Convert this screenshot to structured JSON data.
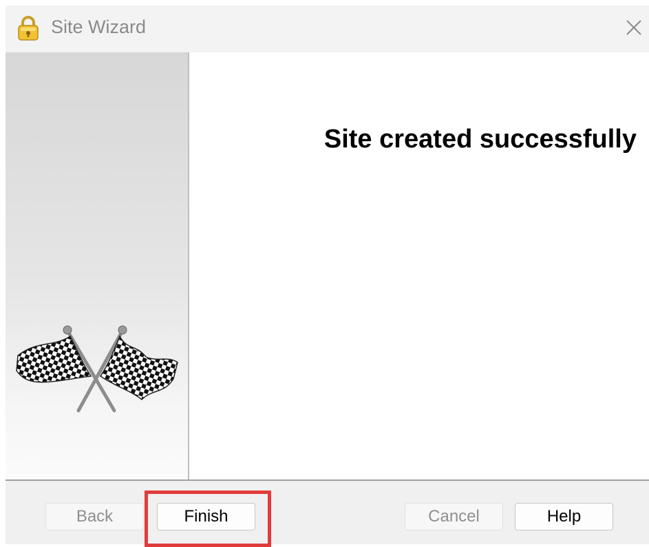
{
  "window": {
    "title": "Site Wizard",
    "title_icon": "lock-icon",
    "close_icon": "close-icon"
  },
  "sidebar": {
    "art_icon": "checkered-flags-icon"
  },
  "content": {
    "heading": "Site created successfully"
  },
  "footer": {
    "back_label": "Back",
    "finish_label": "Finish",
    "cancel_label": "Cancel",
    "help_label": "Help",
    "back_enabled": false,
    "cancel_enabled": false
  },
  "highlight": {
    "target": "finish-button",
    "color": "#e23b3b"
  }
}
